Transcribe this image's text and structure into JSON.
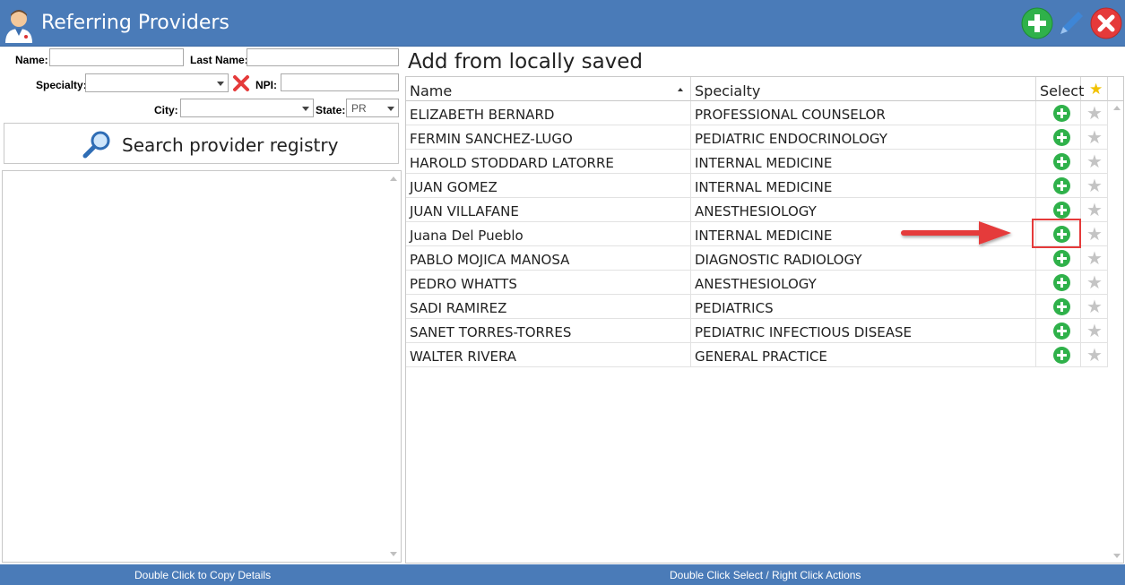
{
  "window": {
    "title": "Referring Providers",
    "icons": [
      "provider-avatar-icon",
      "add-icon",
      "edit-icon",
      "close-icon"
    ]
  },
  "filters": {
    "name_label": "Name:",
    "last_name_label": "Last Name:",
    "specialty_label": "Specialty:",
    "npi_label": "NPI:",
    "city_label": "City:",
    "state_label": "State:",
    "state_value": "PR",
    "name_value": "",
    "last_name_value": "",
    "npi_value": "",
    "specialty_value": "",
    "city_value": ""
  },
  "search": {
    "button_label": "Search provider registry",
    "icon": "magnifier-icon"
  },
  "local": {
    "title": "Add from locally saved",
    "columns": {
      "name": "Name",
      "specialty": "Specialty",
      "select": "Select",
      "favorite": "★"
    },
    "rows": [
      {
        "name": "ELIZABETH BERNARD",
        "specialty": "PROFESSIONAL COUNSELOR"
      },
      {
        "name": "FERMIN SANCHEZ-LUGO",
        "specialty": "PEDIATRIC ENDOCRINOLOGY"
      },
      {
        "name": "HAROLD STODDARD LATORRE",
        "specialty": "INTERNAL MEDICINE"
      },
      {
        "name": "JUAN GOMEZ",
        "specialty": "INTERNAL MEDICINE"
      },
      {
        "name": "JUAN VILLAFANE",
        "specialty": "ANESTHESIOLOGY"
      },
      {
        "name": "Juana  Del Pueblo",
        "specialty": "INTERNAL MEDICINE"
      },
      {
        "name": "PABLO MOJICA MANOSA",
        "specialty": "DIAGNOSTIC RADIOLOGY"
      },
      {
        "name": "PEDRO WHATTS",
        "specialty": "ANESTHESIOLOGY"
      },
      {
        "name": "SADI RAMIREZ",
        "specialty": "PEDIATRICS"
      },
      {
        "name": "SANET TORRES-TORRES",
        "specialty": "PEDIATRIC INFECTIOUS DISEASE"
      },
      {
        "name": "WALTER RIVERA",
        "specialty": "GENERAL PRACTICE"
      }
    ]
  },
  "status": {
    "left": "Double Click to Copy Details",
    "right": "Double Click Select / Right Click Actions"
  },
  "colors": {
    "titlebar": "#4a7bb8",
    "add_green": "#2fb14a",
    "close_red": "#e53a3a",
    "star_gold": "#f2c200",
    "star_gray": "#c4c4c4"
  }
}
